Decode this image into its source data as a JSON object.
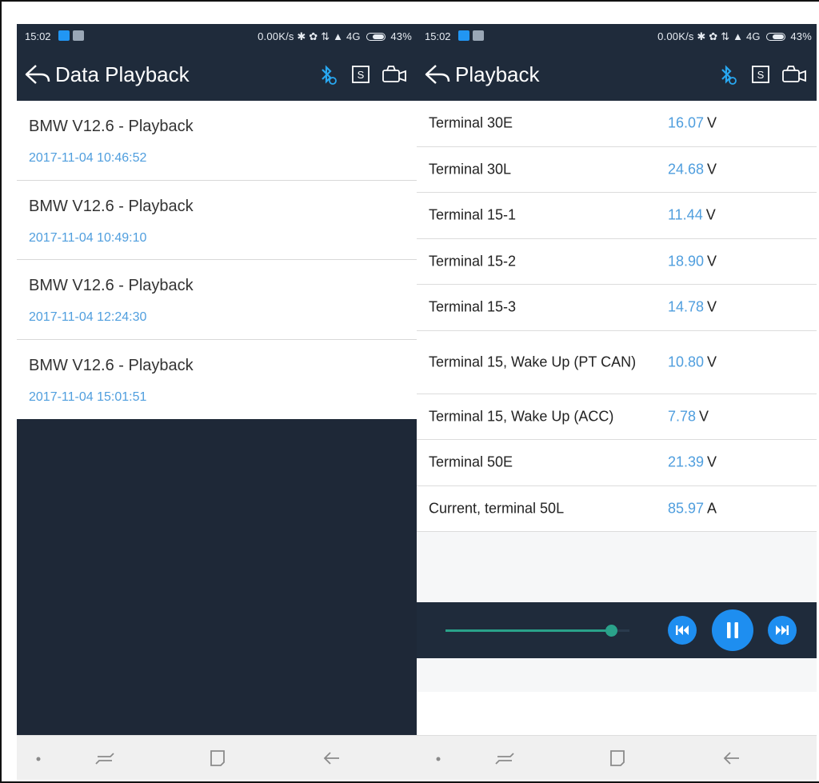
{
  "left_screen": {
    "status": {
      "time": "15:02",
      "network_info": "0.00K/s ✱ ✿ ⇅ ▲ 4G",
      "battery": "43%"
    },
    "toolbar": {
      "title": "Data Playback"
    },
    "files": [
      {
        "name": "BMW V12.6 - Playback",
        "date": "2017-11-04 10:46:52"
      },
      {
        "name": "BMW V12.6 - Playback",
        "date": "2017-11-04 10:49:10"
      },
      {
        "name": "BMW V12.6 - Playback",
        "date": "2017-11-04 12:24:30"
      },
      {
        "name": "BMW V12.6 - Playback",
        "date": "2017-11-04 15:01:51"
      }
    ]
  },
  "right_screen": {
    "status": {
      "time": "15:02",
      "network_info": "0.00K/s ✱ ✿ ⇅ ▲ 4G",
      "battery": "43%"
    },
    "toolbar": {
      "title": "Playback"
    },
    "rows": [
      {
        "label": "Terminal 30E",
        "value": "16.07",
        "unit": "V"
      },
      {
        "label": "Terminal 30L",
        "value": "24.68",
        "unit": "V"
      },
      {
        "label": "Terminal 15-1",
        "value": "11.44",
        "unit": "V"
      },
      {
        "label": "Terminal 15-2",
        "value": "18.90",
        "unit": "V"
      },
      {
        "label": "Terminal 15-3",
        "value": "14.78",
        "unit": "V"
      },
      {
        "label": "Terminal 15, Wake Up (PT CAN)",
        "value": "10.80",
        "unit": "V"
      },
      {
        "label": "Terminal 15, Wake Up (ACC)",
        "value": "7.78",
        "unit": "V"
      },
      {
        "label": "Terminal 50E",
        "value": "21.39",
        "unit": "V"
      },
      {
        "label": "Current, terminal 50L",
        "value": "85.97",
        "unit": "A"
      }
    ],
    "player": {
      "progress": 0.9
    }
  },
  "colors": {
    "header_bg": "#1f2b3b",
    "accent_blue": "#4f9ede",
    "button_blue": "#1e8ef0",
    "slider_green": "#2aa28a",
    "bluetooth_icon": "#28a7f0"
  },
  "icons": [
    "back-arrow-icon",
    "bluetooth-icon",
    "s-box-icon",
    "camera-icon",
    "rewind-icon",
    "pause-icon",
    "fast-forward-icon",
    "nav-dot-icon",
    "recent-apps-icon",
    "home-icon",
    "back-icon"
  ]
}
